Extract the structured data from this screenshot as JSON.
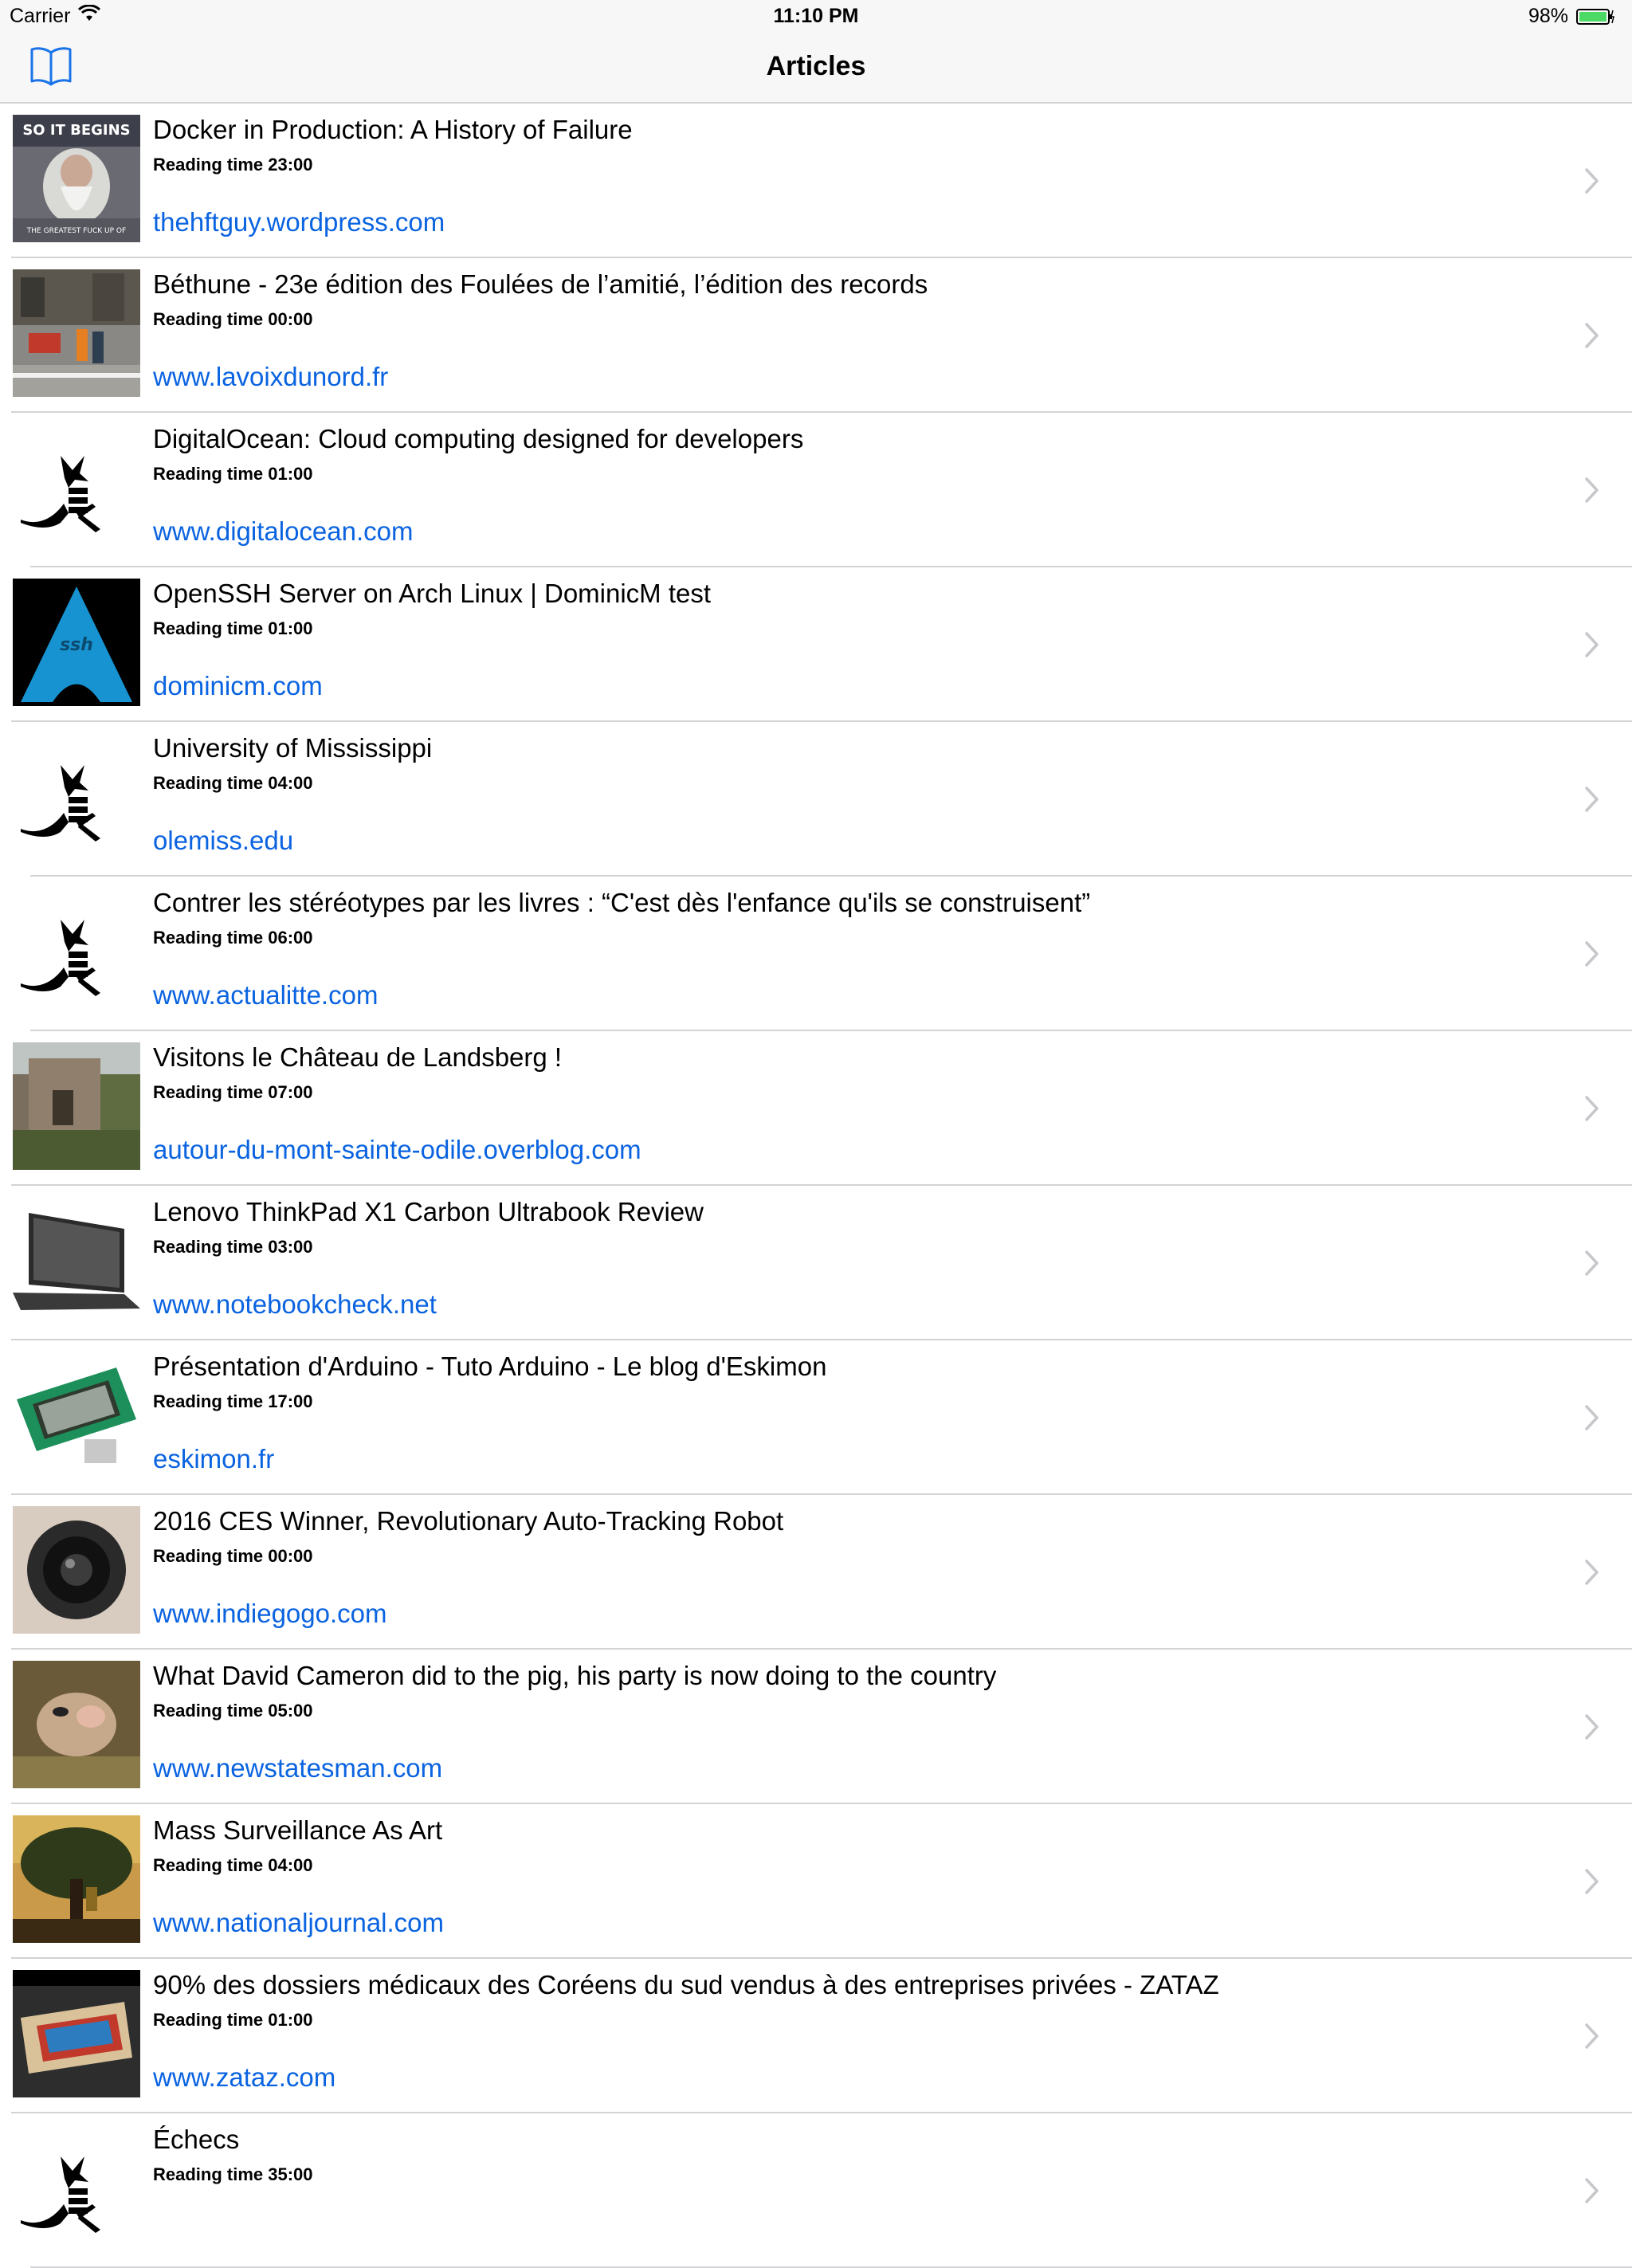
{
  "status_bar": {
    "carrier": "Carrier",
    "time": "11:10 PM",
    "battery_pct": "98%"
  },
  "nav": {
    "title": "Articles",
    "bookmark_icon": "book-icon"
  },
  "reading_prefix": "Reading time",
  "articles": [
    {
      "title": "Docker in Production: A History of Failure",
      "reading_time": "Reading time 23:00",
      "domain": "thehftguy.wordpress.com",
      "thumb": "meme"
    },
    {
      "title": "Béthune - 23e édition des Foulées de l’amitié, l’édition des records",
      "reading_time": "Reading time 00:00",
      "domain": "www.lavoixdunord.fr",
      "thumb": "street"
    },
    {
      "title": "DigitalOcean: Cloud computing designed for developers",
      "reading_time": "Reading time 01:00",
      "domain": "www.digitalocean.com",
      "thumb": "logo"
    },
    {
      "title": "OpenSSH Server on Arch Linux | DominicM test",
      "reading_time": "Reading time 01:00",
      "domain": "dominicm.com",
      "thumb": "arch"
    },
    {
      "title": "University of Mississippi",
      "reading_time": "Reading time 04:00",
      "domain": "olemiss.edu",
      "thumb": "logo"
    },
    {
      "title": "Contrer les stéréotypes par les livres : “C'est dès l'enfance qu'ils se construisent”",
      "reading_time": "Reading time 06:00",
      "domain": "www.actualitte.com",
      "thumb": "logo"
    },
    {
      "title": "Visitons le Château de Landsberg !",
      "reading_time": "Reading time 07:00",
      "domain": "autour-du-mont-sainte-odile.overblog.com",
      "thumb": "castle"
    },
    {
      "title": "Lenovo ThinkPad X1 Carbon Ultrabook Review",
      "reading_time": "Reading time 03:00",
      "domain": "www.notebookcheck.net",
      "thumb": "laptop"
    },
    {
      "title": "Présentation d'Arduino - Tuto Arduino - Le blog d'Eskimon",
      "reading_time": "Reading time 17:00",
      "domain": "eskimon.fr",
      "thumb": "lcd"
    },
    {
      "title": "2016 CES Winner, Revolutionary Auto-Tracking Robot",
      "reading_time": "Reading time 00:00",
      "domain": "www.indiegogo.com",
      "thumb": "camera"
    },
    {
      "title": "What David Cameron did to the pig, his party is now doing to the country",
      "reading_time": "Reading time 05:00",
      "domain": "www.newstatesman.com",
      "thumb": "pig"
    },
    {
      "title": "Mass Surveillance As Art",
      "reading_time": "Reading time 04:00",
      "domain": "www.nationaljournal.com",
      "thumb": "tree"
    },
    {
      "title": "90% des dossiers médicaux des Coréens du sud vendus à des entreprises privées - ZATAZ",
      "reading_time": "Reading time 01:00",
      "domain": "www.zataz.com",
      "thumb": "cards"
    },
    {
      "title": "Échecs",
      "reading_time": "Reading time 35:00",
      "domain": "",
      "thumb": "logo"
    }
  ]
}
